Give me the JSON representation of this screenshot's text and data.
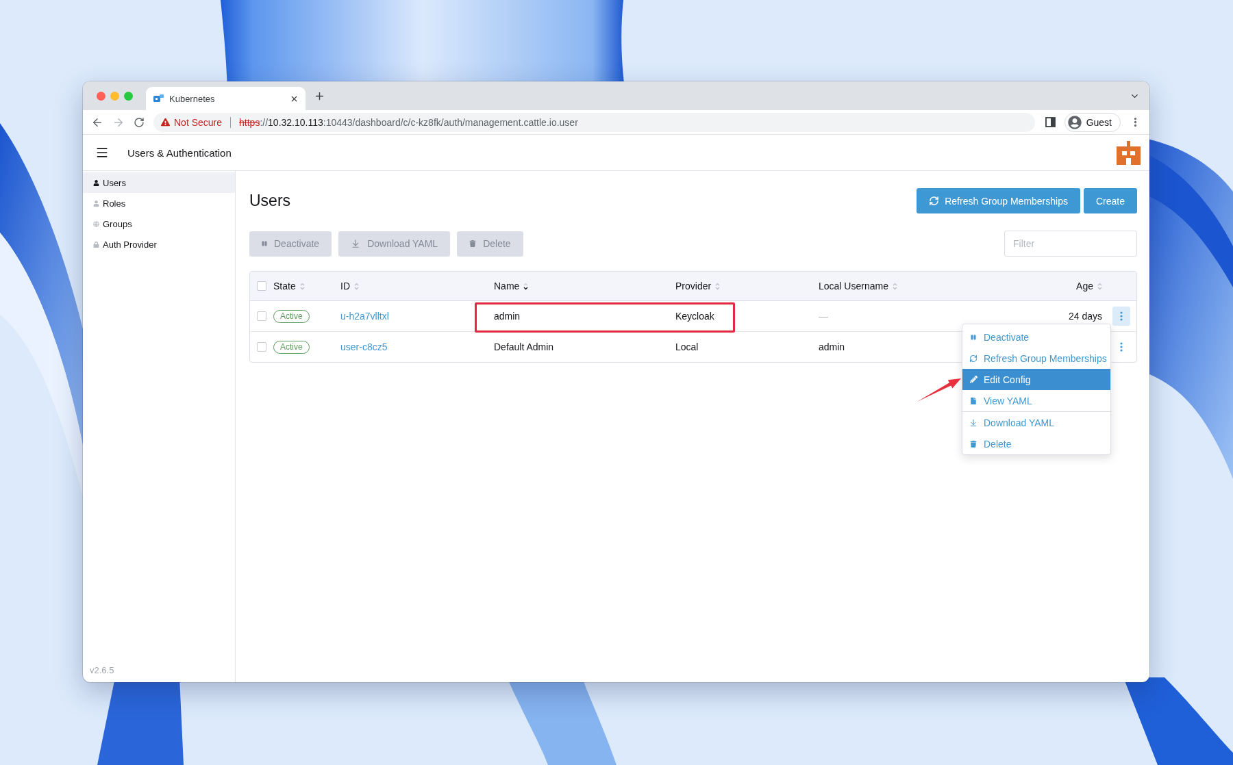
{
  "browser": {
    "tab_title": "Kubernetes",
    "security_label": "Not Secure",
    "url_parts": [
      {
        "text": "https",
        "kind": "insecure_scheme"
      },
      {
        "text": "://",
        "kind": "muted"
      },
      {
        "text": "10.32.10.113",
        "kind": "host"
      },
      {
        "text": ":10443/dashboard/c/c-kz8fk/auth/management.cattle.io.user",
        "kind": "muted"
      }
    ],
    "profile": "Guest"
  },
  "app_header": {
    "title": "Users & Authentication"
  },
  "sidebar": {
    "items": [
      {
        "label": "Users",
        "selected": true
      },
      {
        "label": "Roles",
        "selected": false
      },
      {
        "label": "Groups",
        "selected": false
      },
      {
        "label": "Auth Provider",
        "selected": false
      }
    ],
    "version": "v2.6.5"
  },
  "page": {
    "title": "Users",
    "header_buttons": [
      {
        "label": "Refresh Group Memberships",
        "kind": "refresh"
      },
      {
        "label": "Create",
        "kind": "plain"
      }
    ],
    "bulk_actions": [
      {
        "label": "Deactivate",
        "disabled": true
      },
      {
        "label": "Download YAML",
        "disabled": true
      },
      {
        "label": "Delete",
        "disabled": true
      }
    ],
    "filter": {
      "placeholder": "Filter"
    }
  },
  "table": {
    "select_all": {
      "checked": false
    },
    "columns": [
      {
        "label": "State",
        "sorted": false
      },
      {
        "label": "ID",
        "sorted": false
      },
      {
        "label": "Name",
        "sorted": true
      },
      {
        "label": "Provider",
        "sorted": false
      },
      {
        "label": "Local Username",
        "sorted": false
      },
      {
        "label": "Age",
        "sorted": false
      }
    ],
    "rows": [
      {
        "checked": false,
        "state": "Active",
        "id": "u-h2a7vlltxl",
        "name": "admin",
        "provider": "Keycloak",
        "local_username": "—",
        "local_username_muted": true,
        "age": "24 days",
        "menu_open": true
      },
      {
        "checked": false,
        "state": "Active",
        "id": "user-c8cz5",
        "name": "Default Admin",
        "provider": "Local",
        "local_username": "admin",
        "local_username_muted": false,
        "menu_open": false
      }
    ]
  },
  "row_menu": {
    "sections": [
      {
        "items": [
          {
            "label": "Deactivate",
            "selected": false
          },
          {
            "label": "Refresh Group Memberships",
            "selected": false
          },
          {
            "label": "Edit Config",
            "selected": true
          },
          {
            "label": "View YAML",
            "selected": false
          }
        ]
      },
      {
        "items": [
          {
            "label": "Download YAML",
            "selected": false
          },
          {
            "label": "Delete",
            "selected": false
          }
        ]
      }
    ]
  }
}
